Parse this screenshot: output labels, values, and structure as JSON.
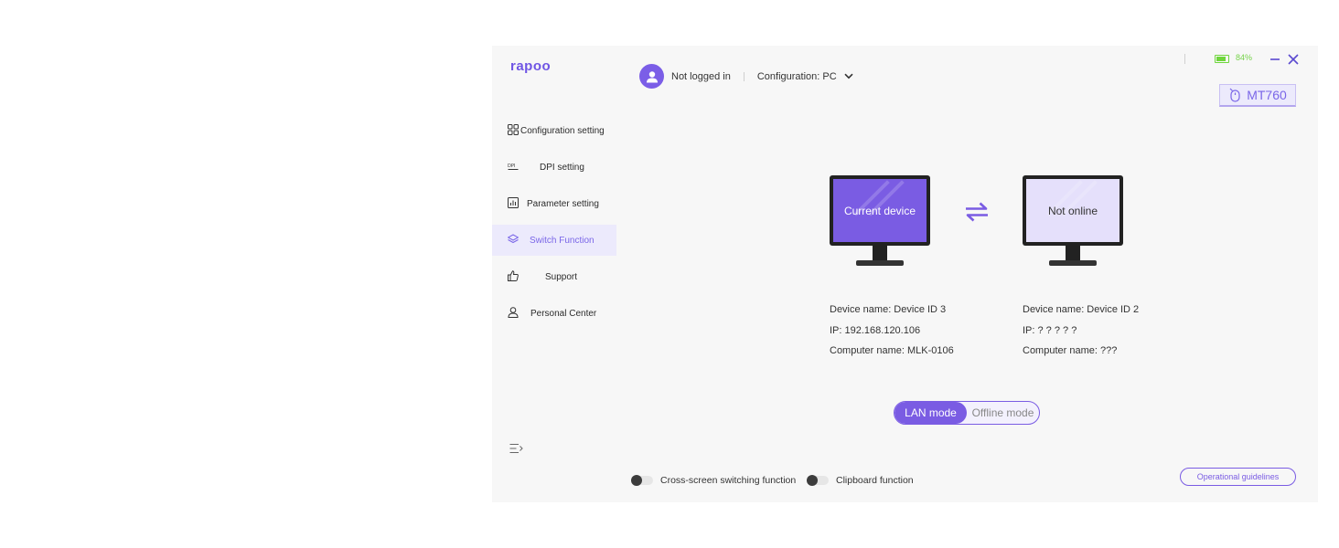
{
  "app": {
    "logo": "rapoo"
  },
  "user": {
    "login_status": "Not logged in",
    "configuration": "Configuration: PC"
  },
  "window": {
    "battery": "84%",
    "battery_level": 0.84,
    "device_model": "MT760"
  },
  "sidebar": {
    "items": [
      {
        "label": "Configuration setting",
        "icon": "grid-icon"
      },
      {
        "label": "DPI setting",
        "icon": "dpi-icon"
      },
      {
        "label": "Parameter setting",
        "icon": "chart-icon"
      },
      {
        "label": "Switch Function",
        "icon": "layers-icon",
        "active": true
      },
      {
        "label": "Support",
        "icon": "thumbs-up-icon"
      },
      {
        "label": "Personal Center",
        "icon": "person-icon"
      }
    ]
  },
  "devices": {
    "current": {
      "screen_label": "Current device",
      "name": "Device name: Device ID 3",
      "ip": "IP: 192.168.120.106",
      "computer": "Computer name: MLK-0106"
    },
    "remote": {
      "screen_label": "Not online",
      "name": "Device name: Device ID 2",
      "ip": "IP: ? ? ? ? ?",
      "computer": "Computer name: ???"
    }
  },
  "mode": {
    "lan": "LAN mode",
    "offline": "Offline mode",
    "selected": "LAN mode"
  },
  "switches": {
    "cross_screen": {
      "label": "Cross-screen switching function",
      "enabled": false
    },
    "clipboard": {
      "label": "Clipboard function",
      "enabled": false
    }
  },
  "footer": {
    "guidelines": "Operational guidelines"
  },
  "colors": {
    "accent": "#7a5ce3",
    "battery": "#6fd63c",
    "active_bg": "#eceafc"
  }
}
